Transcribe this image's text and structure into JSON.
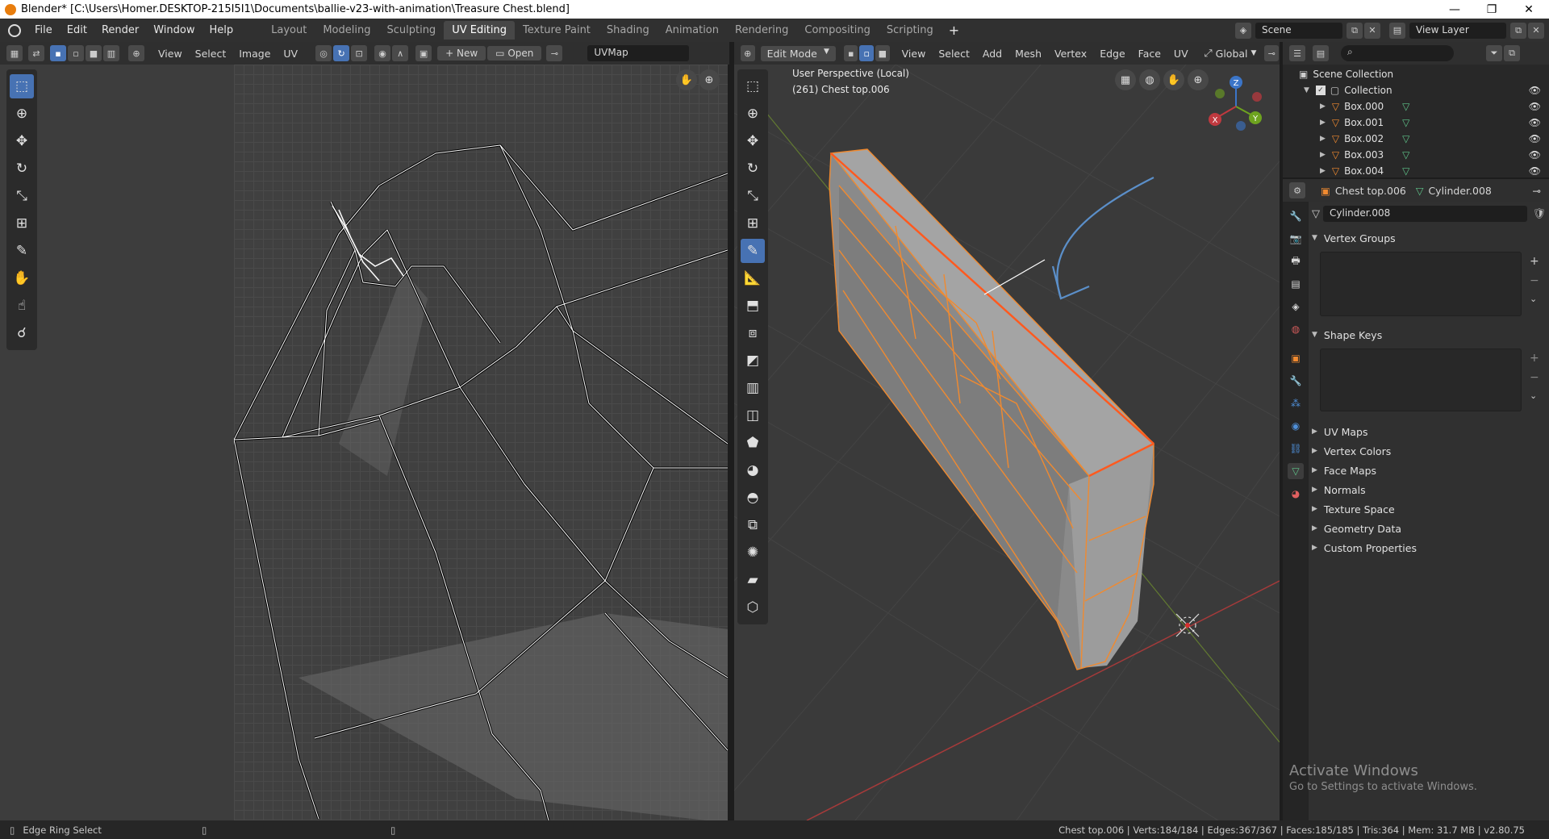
{
  "window": {
    "title": "Blender* [C:\\Users\\Homer.DESKTOP-215I5I1\\Documents\\ballie-v23-with-animation\\Treasure Chest.blend]",
    "minimize": "—",
    "maximize": "❐",
    "close": "✕"
  },
  "menu": [
    "File",
    "Edit",
    "Render",
    "Window",
    "Help"
  ],
  "workspaces": [
    "Layout",
    "Modeling",
    "Sculpting",
    "UV Editing",
    "Texture Paint",
    "Shading",
    "Animation",
    "Rendering",
    "Compositing",
    "Scripting"
  ],
  "active_workspace": "UV Editing",
  "scene": {
    "name": "Scene",
    "view_layer": "View Layer"
  },
  "uv_editor": {
    "menus": [
      "View",
      "Select",
      "Image",
      "UV"
    ],
    "new_label": "New",
    "open_label": "Open",
    "uvmap": "UVMap"
  },
  "viewport": {
    "mode": "Edit Mode",
    "menus": [
      "View",
      "Select",
      "Add",
      "Mesh",
      "Vertex",
      "Edge",
      "Face",
      "UV"
    ],
    "orientation": "Global",
    "perspective_label": "User Perspective (Local)",
    "object_label": "(261) Chest top.006",
    "gizmo": {
      "x": "X",
      "y": "Y",
      "z": "Z"
    }
  },
  "outliner": {
    "root": "Scene Collection",
    "collection": "Collection",
    "items": [
      "Box.000",
      "Box.001",
      "Box.002",
      "Box.003",
      "Box.004"
    ]
  },
  "properties": {
    "object_name": "Chest top.006",
    "mesh_name": "Cylinder.008",
    "data_name": "Cylinder.008",
    "panels_open": [
      "Vertex Groups",
      "Shape Keys"
    ],
    "panels_closed": [
      "UV Maps",
      "Vertex Colors",
      "Face Maps",
      "Normals",
      "Texture Space",
      "Geometry Data",
      "Custom Properties"
    ]
  },
  "watermark": {
    "title": "Activate Windows",
    "subtitle": "Go to Settings to activate Windows."
  },
  "status": {
    "left": "Edge Ring Select",
    "right": "Chest top.006 | Verts:184/184 | Edges:367/367 | Faces:185/185 | Tris:364 | Mem: 31.7 MB | v2.80.75"
  },
  "colors": {
    "accent": "#4772b3",
    "selection_orange": "#f08a30",
    "active_edge": "#ff5a1f",
    "annotation_arrow": "#5b8fc9",
    "x_axis": "#c0393f",
    "y_axis": "#6ea31f",
    "z_axis": "#3b75c8"
  }
}
